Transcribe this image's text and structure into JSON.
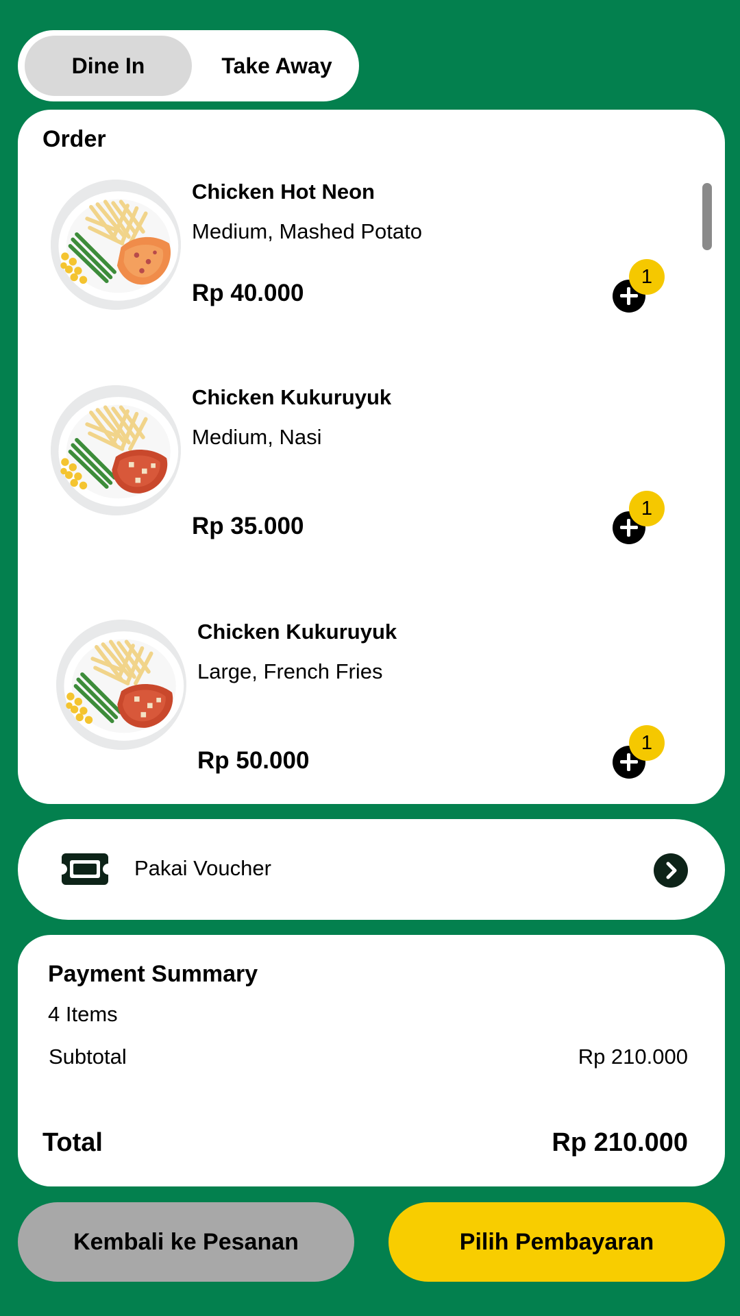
{
  "order_type": {
    "options": [
      "Dine In",
      "Take Away"
    ],
    "selected": "Dine In"
  },
  "order": {
    "title": "Order",
    "items": [
      {
        "name": "Chicken Hot Neon",
        "options": "Medium, Mashed Potato",
        "price": "Rp 40.000",
        "quantity": "1",
        "image": "chicken-fries-plate-image"
      },
      {
        "name": "Chicken Kukuruyuk",
        "options": "Medium, Nasi",
        "price": "Rp 35.000",
        "quantity": "1",
        "image": "chicken-fries-plate-image"
      },
      {
        "name": "Chicken Kukuruyuk",
        "options": "Large, French Fries",
        "price": "Rp 50.000",
        "quantity": "1",
        "image": "chicken-fries-plate-image"
      }
    ]
  },
  "voucher": {
    "label": "Pakai Voucher",
    "icon": "ticket-icon",
    "arrow_icon": "chevron-right-icon"
  },
  "payment_summary": {
    "title": "Payment Summary",
    "items_count": "4 Items",
    "subtotal_label": "Subtotal",
    "subtotal_value": "Rp 210.000",
    "total_label": "Total",
    "total_value": "Rp 210.000"
  },
  "buttons": {
    "back": "Kembali ke Pesanan",
    "pay": "Pilih Pembayaran"
  },
  "colors": {
    "background": "#03804e",
    "card": "#ffffff",
    "selected_toggle": "#d9d9d9",
    "badge": "#f5c800",
    "back_button": "#a8a8a8",
    "pay_button": "#f8cd00"
  }
}
